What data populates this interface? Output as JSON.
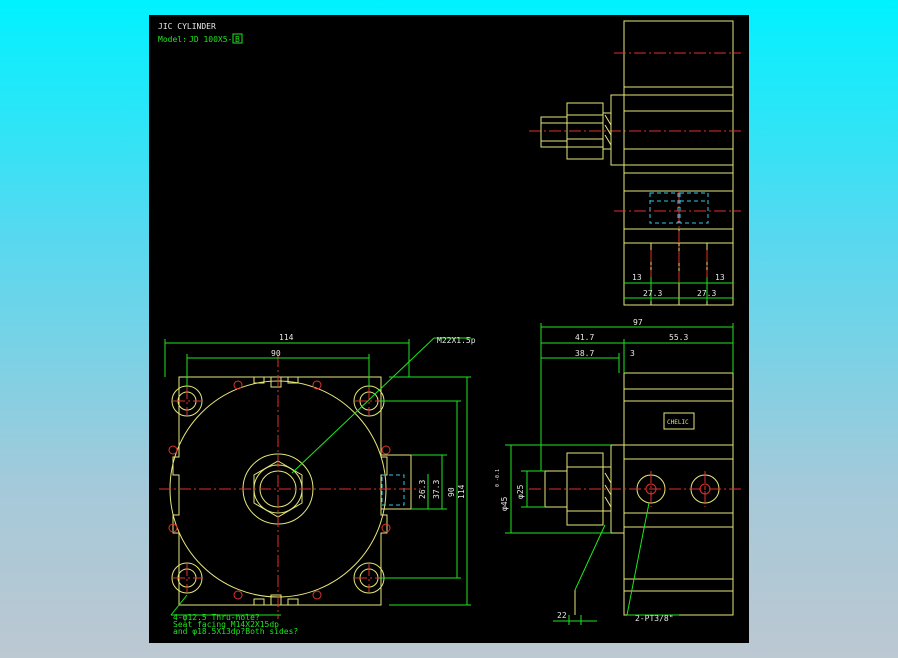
{
  "title": "JIC CYLINDER",
  "model": {
    "prefix": "Model:",
    "value": "JD 100X5-",
    "suffix_box": "B"
  },
  "dimensions": {
    "width_114": "114",
    "width_90": "90",
    "thread": "M22X1.5p",
    "h_26_3": "26.3",
    "h_37_3": "37.3",
    "h_90": "90",
    "h_114": "114",
    "total_97": "97",
    "d_41_7": "41.7",
    "d_55_3": "55.3",
    "d_38_7": "38.7",
    "d_3": "3",
    "dia_45": "φ45",
    "dia_45_tol": "0\n-0.1",
    "dia_25": "φ25",
    "d_13_left": "13",
    "d_13_right": "13",
    "d_27_3_left": "27.3",
    "d_27_3_right": "27.3",
    "d_22": "22",
    "port": "2-PT3/8\""
  },
  "notes": {
    "line1": "4-φ12.5 Thru-hole?",
    "line2": "Seat facing  M14X2X15dp",
    "line3": "and φ18.5X13dp?Both sides?"
  },
  "label_plate": "CHELIC"
}
